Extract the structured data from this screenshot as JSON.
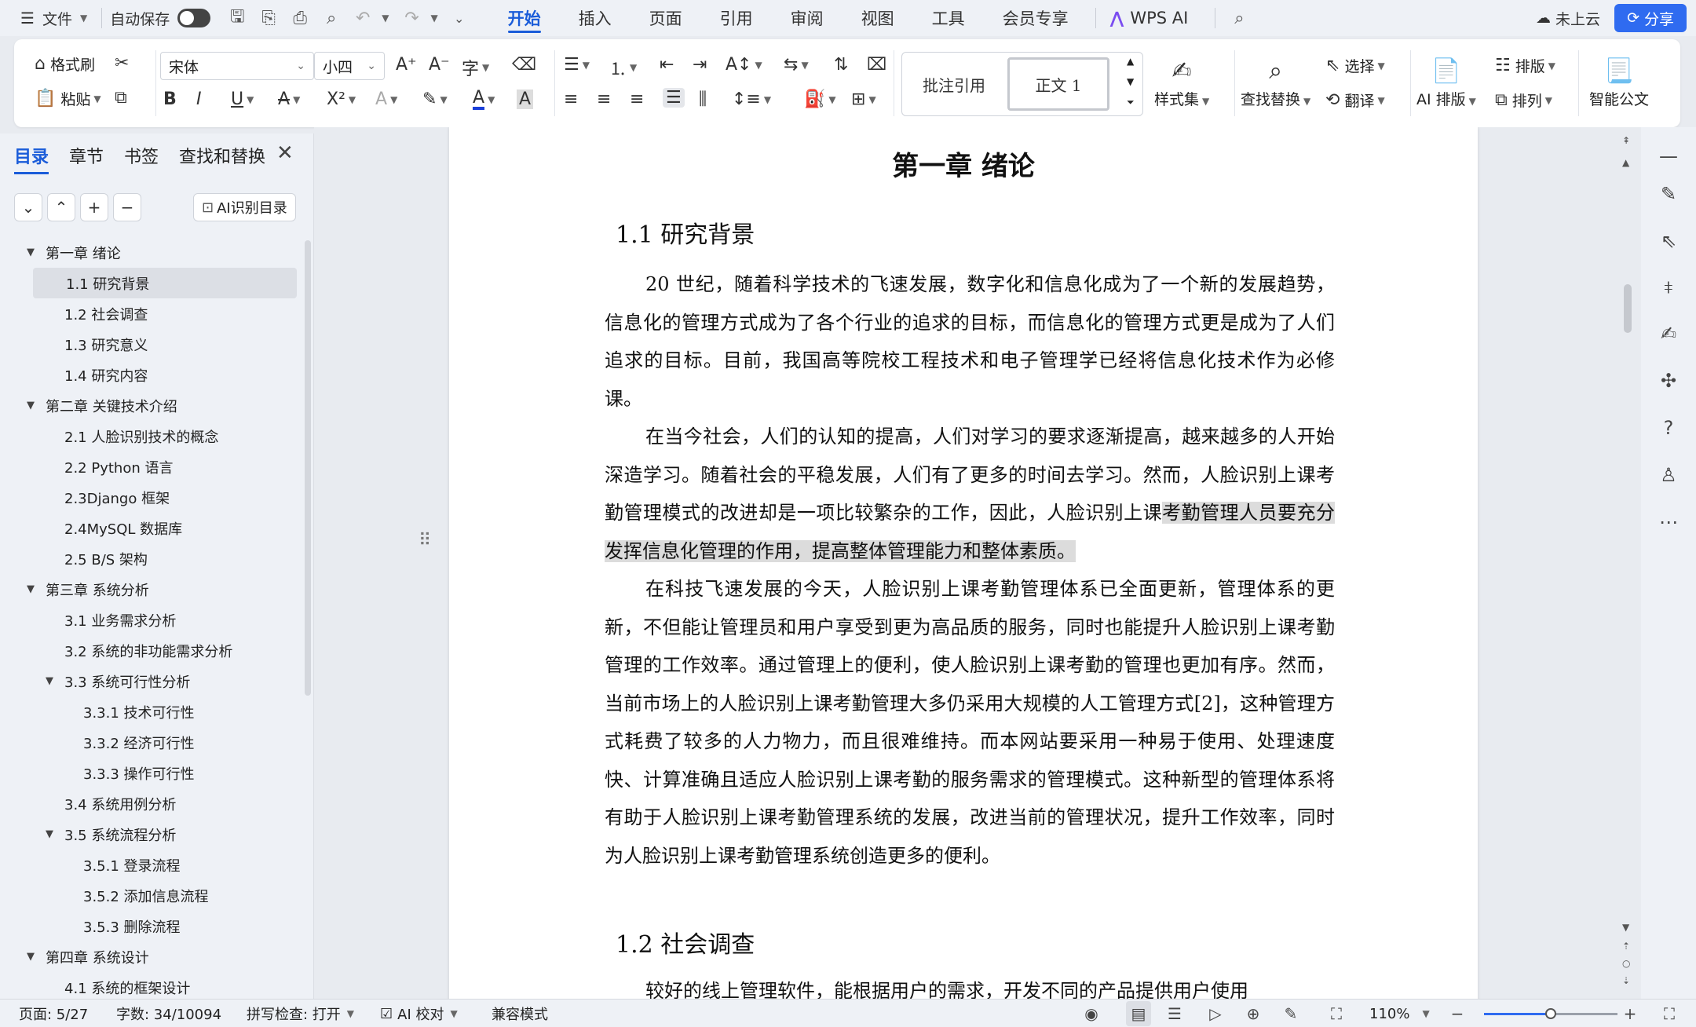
{
  "menubar": {
    "file_label": "文件",
    "autosave_label": "自动保存",
    "tabs": [
      "开始",
      "插入",
      "页面",
      "引用",
      "审阅",
      "视图",
      "工具",
      "会员专享"
    ],
    "wps_ai_label": "WPS AI",
    "cloud_label": "未上云",
    "share_label": "分享",
    "accent_color": "#1a5cd9"
  },
  "ribbon": {
    "format_painter": "格式刷",
    "paste": "粘贴",
    "font_name": "宋体",
    "font_size": "小四",
    "style_comment": "批注引用",
    "style_body": "正文 1",
    "style_set": "样式集",
    "find_replace": "查找替换",
    "select": "选择",
    "translate": "翻译",
    "ai_layout": "AI 排版",
    "layout": "排版",
    "arrange": "排列",
    "smart_doc": "智能公文"
  },
  "nav": {
    "tabs": [
      "目录",
      "章节",
      "书签",
      "查找和替换"
    ],
    "ai_toc": "AI识别目录",
    "toc": [
      {
        "label": "第一章  绪论",
        "level": 0,
        "caret": true
      },
      {
        "label": "1.1 研究背景",
        "level": 1,
        "selected": true
      },
      {
        "label": "1.2 社会调查",
        "level": 1
      },
      {
        "label": "1.3 研究意义",
        "level": 1
      },
      {
        "label": "1.4 研究内容",
        "level": 1
      },
      {
        "label": "第二章  关键技术介绍",
        "level": 0,
        "caret": true
      },
      {
        "label": "2.1 人脸识别技术的概念",
        "level": 1
      },
      {
        "label": "2.2 Python 语言",
        "level": 1
      },
      {
        "label": "2.3Django 框架",
        "level": 1
      },
      {
        "label": "2.4MySQL 数据库",
        "level": 1
      },
      {
        "label": "2.5 B/S 架构",
        "level": 1
      },
      {
        "label": "第三章  系统分析",
        "level": 0,
        "caret": true
      },
      {
        "label": "3.1 业务需求分析",
        "level": 1
      },
      {
        "label": "3.2 系统的非功能需求分析",
        "level": 1
      },
      {
        "label": "3.3 系统可行性分析",
        "level": 1,
        "caret": true
      },
      {
        "label": "3.3.1  技术可行性",
        "level": 2
      },
      {
        "label": "3.3.2  经济可行性",
        "level": 2
      },
      {
        "label": "3.3.3  操作可行性",
        "level": 2
      },
      {
        "label": "3.4  系统用例分析",
        "level": 1
      },
      {
        "label": "3.5  系统流程分析",
        "level": 1,
        "caret": true
      },
      {
        "label": "3.5.1  登录流程",
        "level": 2
      },
      {
        "label": "3.5.2  添加信息流程",
        "level": 2
      },
      {
        "label": "3.5.3  删除流程",
        "level": 2
      },
      {
        "label": "第四章  系统设计",
        "level": 0,
        "caret": true
      },
      {
        "label": "4.1 系统的框架设计",
        "level": 1
      }
    ]
  },
  "document": {
    "chapter_title": "第一章  绪论",
    "section1_title": "1.1 研究背景",
    "para1": "20 世纪，随着科学技术的飞速发展，数字化和信息化成为了一个新的发展趋势，信息化的管理方式成为了各个行业的追求的目标，而信息化的管理方式更是成为了人们追求的目标。目前，我国高等院校工程技术和电子管理学已经将信息化技术作为必修课。",
    "para2a": "在当今社会，人们的认知的提高，人们对学习的要求逐渐提高，越来越多的人开始深造学习。随着社会的平稳发展，人们有了更多的时间去学习。然而，人脸识别上课考勤管理模式的改进却是一项比较繁杂的工作，因此，人脸识别上课",
    "para2b": "考勤管理人员要充分发挥信息化管理的作用，提高整体管理能力和整体素质。",
    "para3": "在科技飞速发展的今天，人脸识别上课考勤管理体系已全面更新，管理体系的更新，不但能让管理员和用户享受到更为高品质的服务，同时也能提升人脸识别上课考勤管理的工作效率。通过管理上的便利，使人脸识别上课考勤的管理也更加有序。然而，当前市场上的人脸识别上课考勤管理大多仍采用大规模的人工管理方式[2]，这种管理方式耗费了较多的人力物力，而且很难维持。而本网站要采用一种易于使用、处理速度快、计算准确且适应人脸识别上课考勤的服务需求的管理模式。这种新型的管理体系将有助于人脸识别上课考勤管理系统的发展，改进当前的管理状况，提升工作效率，同时为人脸识别上课考勤管理系统创造更多的便利。",
    "section2_title": "1.2 社会调查",
    "para4_partial": "较好的线上管理软件，能根据用户的需求，开发不同的产品提供用户使用"
  },
  "status": {
    "page": "页面: 5/27",
    "words": "字数: 34/10094",
    "spell": "拼写检查: 打开",
    "ai_check": "AI 校对",
    "compat": "兼容模式",
    "zoom": "110%",
    "zoom_fraction": 0.5
  }
}
